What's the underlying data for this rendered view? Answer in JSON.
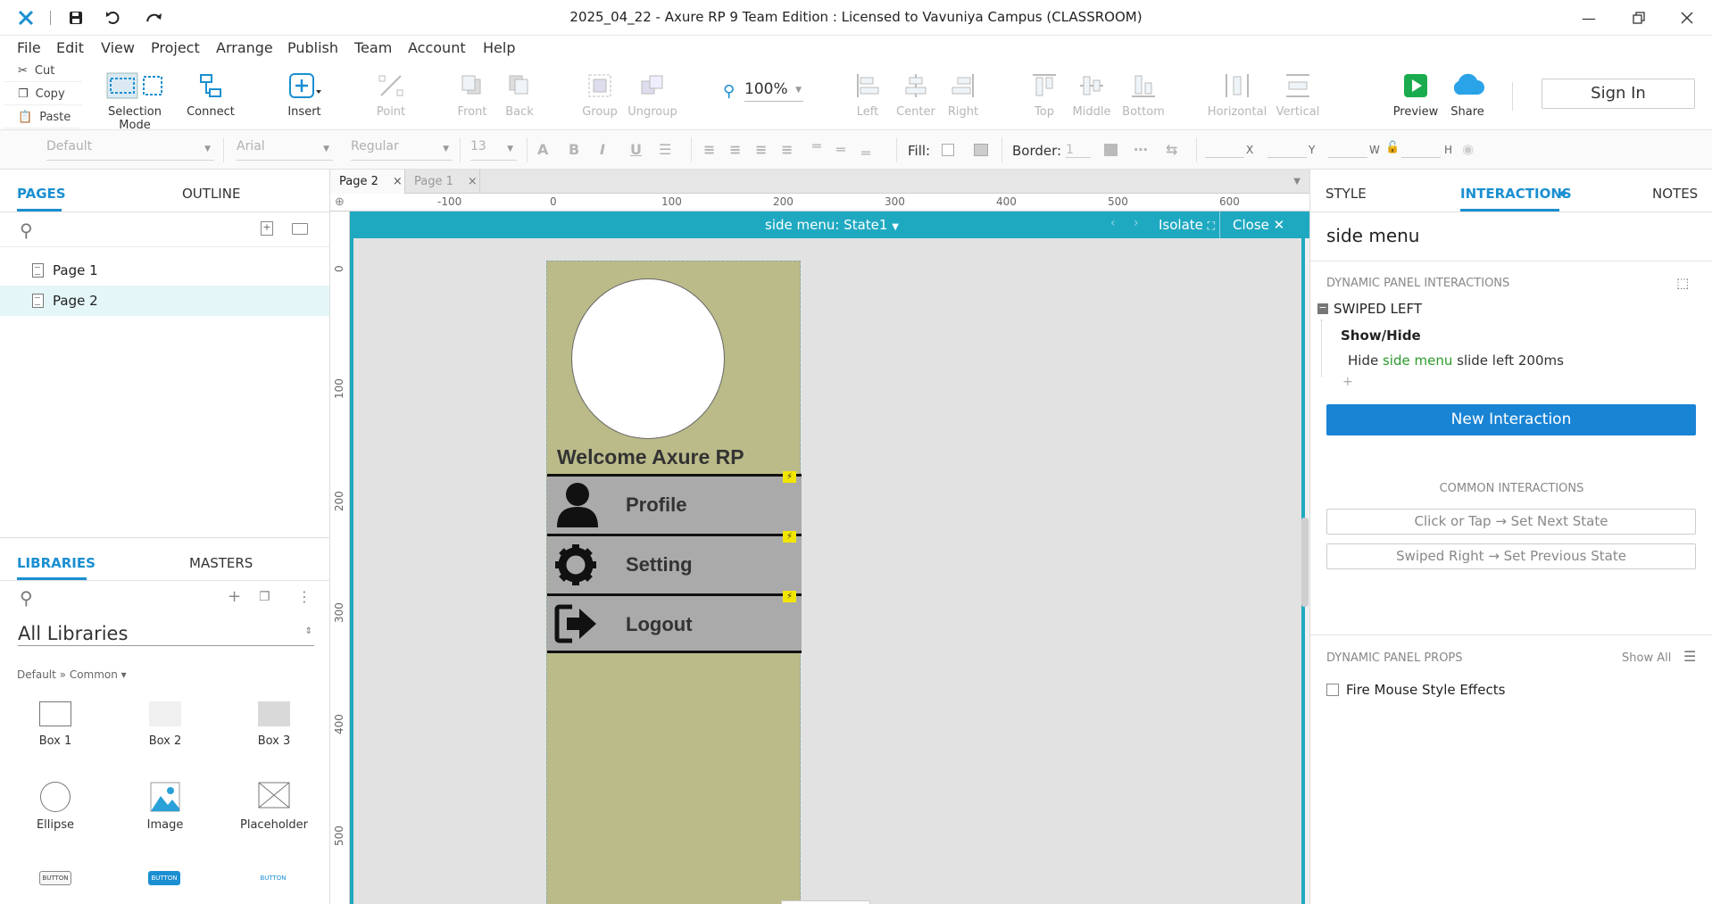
{
  "window": {
    "title": "2025_04_22 - Axure RP 9 Team Edition : Licensed to Vavuniya Campus (CLASSROOM)"
  },
  "menubar": [
    "File",
    "Edit",
    "View",
    "Project",
    "Arrange",
    "Publish",
    "Team",
    "Account",
    "Help"
  ],
  "clipboard": {
    "cut": "Cut",
    "copy": "Copy",
    "paste": "Paste"
  },
  "toolbar": {
    "selection_mode": "Selection Mode",
    "connect": "Connect",
    "insert": "Insert",
    "point": "Point",
    "front": "Front",
    "back": "Back",
    "group": "Group",
    "ungroup": "Ungroup",
    "zoom": "100%",
    "left": "Left",
    "center": "Center",
    "right": "Right",
    "top": "Top",
    "middle": "Middle",
    "bottom": "Bottom",
    "horizontal": "Horizontal",
    "vertical": "Vertical",
    "preview": "Preview",
    "share": "Share",
    "sign_in": "Sign In"
  },
  "format": {
    "style": "Default",
    "font": "Arial",
    "weight": "Regular",
    "size": "13",
    "fill_label": "Fill:",
    "border_label": "Border:",
    "border_value": "1",
    "x_label": "X",
    "y_label": "Y",
    "w_label": "W",
    "h_label": "H"
  },
  "left_panel": {
    "tabs": {
      "pages": "PAGES",
      "outline": "OUTLINE"
    },
    "pages": [
      "Page 1",
      "Page 2"
    ],
    "selected_page": "Page 2",
    "lib_tabs": {
      "libraries": "LIBRARIES",
      "masters": "MASTERS"
    },
    "library_select": "All Libraries",
    "library_path": "Default » Common ▾",
    "widgets": [
      "Box 1",
      "Box 2",
      "Box 3",
      "Ellipse",
      "Image",
      "Placeholder"
    ],
    "button_widget_text": "BUTTON"
  },
  "canvas": {
    "tabs": [
      "Page 2",
      "Page 1"
    ],
    "ruler_h": [
      "-100",
      "0",
      "100",
      "200",
      "300",
      "400",
      "500",
      "600"
    ],
    "ruler_v": [
      "0",
      "100",
      "200",
      "300",
      "400",
      "500"
    ],
    "dp_header": {
      "state": "side menu: State1",
      "isolate": "Isolate",
      "close": "Close"
    },
    "side_menu": {
      "welcome": "Welcome Axure RP",
      "items": [
        "Profile",
        "Setting",
        "Logout"
      ]
    }
  },
  "right_panel": {
    "tabs": {
      "style": "STYLE",
      "interactions": "INTERACTIONS",
      "notes": "NOTES"
    },
    "widget_name": "side menu",
    "dp_interactions_title": "DYNAMIC PANEL INTERACTIONS",
    "event": "SWIPED LEFT",
    "action": "Show/Hide",
    "detail": {
      "prefix": "Hide",
      "target": "side menu",
      "suffix": "slide left 200ms"
    },
    "new_interaction": "New Interaction",
    "common_title": "COMMON INTERACTIONS",
    "common": [
      "Click or Tap → Set Next State",
      "Swiped Right → Set Previous State"
    ],
    "props_title": "DYNAMIC PANEL PROPS",
    "show_all": "Show All",
    "fire_mouse": "Fire Mouse Style Effects"
  },
  "colors": {
    "accent": "#1a8fd1",
    "dp_header": "#1fa9c1",
    "panel_bg": "#bbbb8a",
    "menu_row": "#aaaaaa",
    "new_interaction": "#1a84d4",
    "preview_green": "#1aab4e",
    "share_blue": "#2aa3e8",
    "interaction_target": "#2a9a2a"
  },
  "icons": [
    "axure-logo-icon",
    "save-icon",
    "undo-icon",
    "redo-icon",
    "minimize-icon",
    "restore-icon",
    "close-icon",
    "person-icon",
    "gear-icon",
    "logout-icon",
    "lightning-icon"
  ]
}
